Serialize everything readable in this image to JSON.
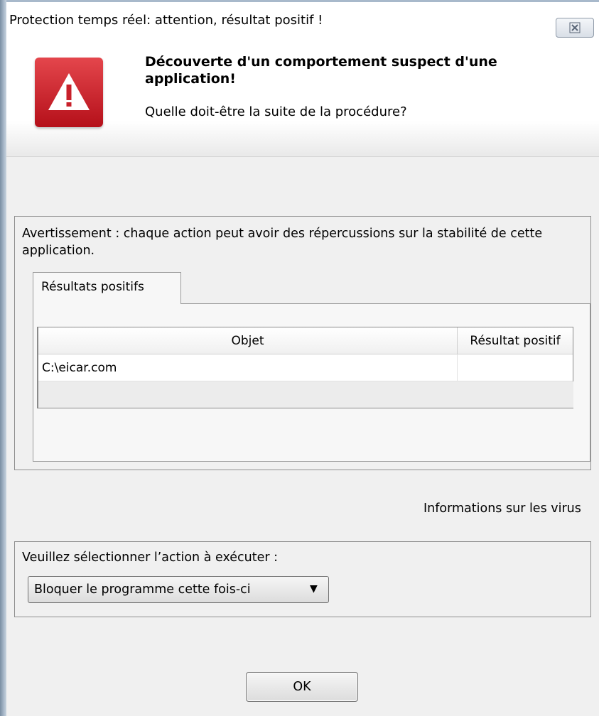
{
  "window": {
    "title": "Protection temps réel: attention, résultat positif !",
    "close_glyph": "☒"
  },
  "header": {
    "icon": "warning-triangle-icon",
    "headline": "Découverte d'un comportement suspect d'une application!",
    "question": "Quelle doit-être la suite de la procédure?"
  },
  "warning_group": {
    "text": "Avertissement : chaque action peut avoir des répercussions sur la stabilité de cette application.",
    "tab_label": "Résultats positifs",
    "table": {
      "columns": [
        "Objet",
        "Résultat positif"
      ],
      "rows": [
        {
          "object": "C:\\eicar.com",
          "result": ""
        }
      ]
    }
  },
  "virus_info_link": "Informations sur les virus",
  "action_group": {
    "label": "Veuillez sélectionner l’action à exécuter :",
    "selected": "Bloquer le programme cette fois-ci"
  },
  "ok_button": "OK",
  "colors": {
    "icon_red": "#c8202a",
    "window_bg": "#f0f0f0"
  }
}
